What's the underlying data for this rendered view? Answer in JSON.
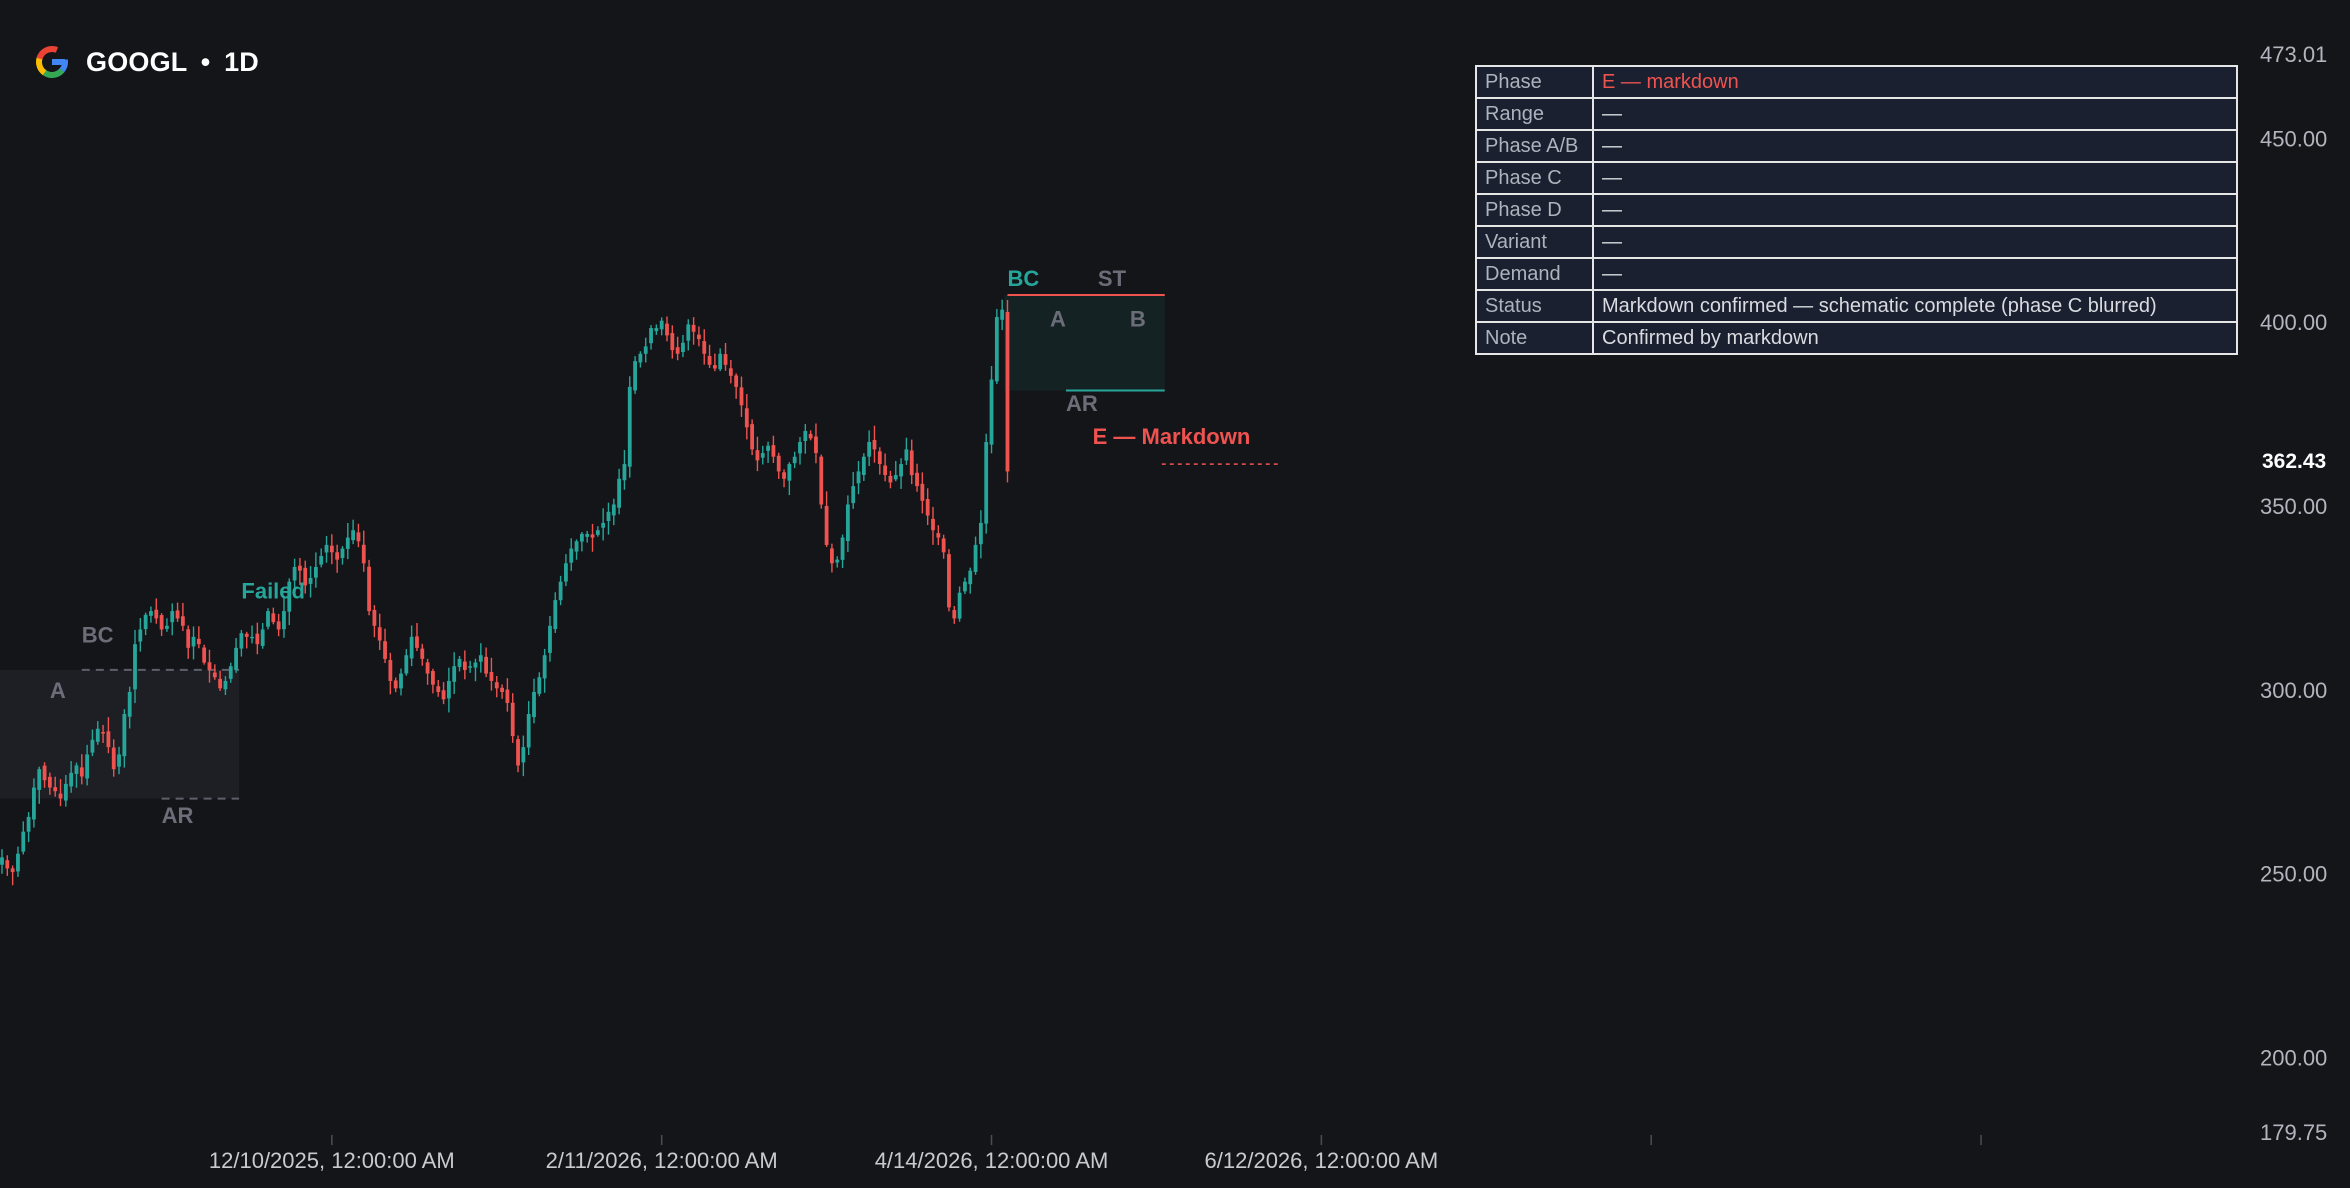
{
  "header": {
    "ticker": "GOOGL",
    "separator": "•",
    "interval": "1D",
    "logo": "google-g-icon"
  },
  "info_table": [
    {
      "key": "Phase",
      "value": "E — markdown",
      "highlight": true
    },
    {
      "key": "Range",
      "value": "—"
    },
    {
      "key": "Phase A/B",
      "value": "—"
    },
    {
      "key": "Phase C",
      "value": "—"
    },
    {
      "key": "Phase D",
      "value": "—"
    },
    {
      "key": "Variant",
      "value": "—"
    },
    {
      "key": "Demand",
      "value": "—"
    },
    {
      "key": "Status",
      "value": "Markdown confirmed — schematic complete (phase C blurred)"
    },
    {
      "key": "Note",
      "value": "Confirmed by markdown"
    }
  ],
  "colors": {
    "up": "#26a69a",
    "down": "#ef5350",
    "background": "#141519",
    "text": "#d1d4dc",
    "muted": "#787b86",
    "table_bg": "#1b2030"
  },
  "chart_data": {
    "type": "candlestick",
    "symbol": "GOOGL",
    "interval": "1D",
    "ylim": [
      179.75,
      473.01
    ],
    "y_ticks": [
      200,
      250,
      300,
      350,
      400,
      450
    ],
    "y_tick_labels": [
      "200.00",
      "250.00",
      "300.00",
      "350.00",
      "400.00",
      "450.00"
    ],
    "y_bound_labels": [
      "179.75",
      "473.01"
    ],
    "last_price": 362.43,
    "last_price_label": "362.43",
    "x_labels": [
      "12/10/2025, 12:00:00 AM",
      "2/11/2026, 12:00:00 AM",
      "4/14/2026, 12:00:00 AM",
      "6/12/2026, 12:00:00 AM"
    ],
    "x_label_bars": [
      62,
      124,
      186,
      248
    ],
    "x_extra_tick_bars": [
      310,
      372
    ],
    "grid": false,
    "close": [
      255,
      252,
      251,
      256,
      262,
      266,
      274,
      279,
      276,
      274,
      273,
      271,
      275,
      278,
      280,
      277,
      283,
      287,
      290,
      289,
      285,
      279,
      283,
      294,
      300,
      313,
      317,
      321,
      322,
      320,
      317,
      318,
      322,
      320,
      318,
      312,
      315,
      313,
      308,
      306,
      304,
      301,
      303,
      307,
      312,
      316,
      315,
      315,
      313,
      317,
      322,
      319,
      317,
      322,
      330,
      334,
      333,
      329,
      331,
      334,
      337,
      340,
      338,
      336,
      339,
      342,
      344,
      341,
      335,
      322,
      318,
      314,
      309,
      303,
      301,
      305,
      310,
      315,
      312,
      309,
      305,
      302,
      300,
      298,
      303,
      307,
      309,
      306,
      307,
      308,
      310,
      305,
      303,
      301,
      300,
      297,
      288,
      280,
      285,
      294,
      300,
      304,
      310,
      318,
      325,
      330,
      335,
      339,
      341,
      343,
      343,
      342,
      344,
      346,
      349,
      351,
      358,
      362,
      383,
      390,
      392,
      394,
      399,
      399,
      401,
      397,
      393,
      392,
      395,
      400,
      398,
      396,
      392,
      389,
      388,
      392,
      389,
      386,
      383,
      378,
      372,
      366,
      363,
      365,
      367,
      364,
      360,
      358,
      362,
      364,
      368,
      371,
      369,
      365,
      351,
      340,
      335,
      336,
      342,
      351,
      356,
      360,
      364,
      368,
      366,
      362,
      359,
      357,
      359,
      362,
      366,
      359,
      356,
      352,
      348,
      344,
      342,
      338,
      323,
      320,
      327,
      330,
      333,
      340,
      346,
      368,
      385,
      402,
      404,
      360
    ],
    "annotations": [
      {
        "text": "BC",
        "bar": 15,
        "price": 315,
        "style": "muted"
      },
      {
        "text": "A",
        "bar": 9,
        "price": 300,
        "style": "muted"
      },
      {
        "text": "AR",
        "bar": 30,
        "price": 266,
        "style": "muted"
      },
      {
        "text": "Failed",
        "bar": 45,
        "price": 327,
        "style": "up"
      },
      {
        "text": "BC",
        "bar": 189,
        "price": 412,
        "style": "up"
      },
      {
        "text": "ST",
        "bar": 206,
        "price": 412,
        "style": "muted"
      },
      {
        "text": "A",
        "bar": 197,
        "price": 401,
        "style": "muted"
      },
      {
        "text": "B",
        "bar": 212,
        "price": 401,
        "style": "muted"
      },
      {
        "text": "AR",
        "bar": 200,
        "price": 378,
        "style": "muted"
      },
      {
        "text": "E — Markdown",
        "bar": 205,
        "price": 369,
        "style": "down"
      }
    ],
    "ranges": [
      {
        "bar_start": 0,
        "bar_end": 44,
        "top": 306,
        "bottom": 271,
        "style": "muted"
      },
      {
        "bar_start": 189,
        "bar_end": 218,
        "top": 408,
        "bottom": 382,
        "style": "range"
      }
    ],
    "levels": [
      {
        "price": 306,
        "bar_start": 15,
        "bar_end": 44,
        "style": "dashed-muted"
      },
      {
        "price": 271,
        "bar_start": 30,
        "bar_end": 44,
        "style": "dashed-muted"
      },
      {
        "price": 408,
        "bar_start": 189,
        "bar_end": 218,
        "style": "solid-down"
      },
      {
        "price": 382,
        "bar_start": 200,
        "bar_end": 218,
        "style": "solid-up"
      },
      {
        "price": 362,
        "bar_start": 218,
        "bar_end": 240,
        "style": "dashed-down"
      }
    ]
  }
}
